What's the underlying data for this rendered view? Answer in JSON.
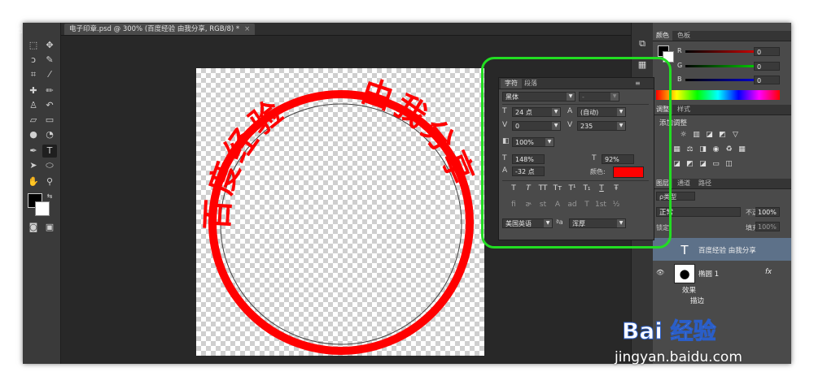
{
  "document_tab": {
    "title": "电子印章.psd @ 300% (百度经验  由我分享, RGB/8) *",
    "close": "×"
  },
  "char_panel": {
    "tabs": [
      "字符",
      "段落"
    ],
    "font_family": "黑体",
    "font_style": "-",
    "font_size": "24 点",
    "leading": "(自动)",
    "kerning": "0",
    "tracking": "235",
    "vertical_scale": "100%",
    "horizontal_scale": "148%",
    "baseline_shift": "-32 点",
    "horizontal_scale2": "92%",
    "color_label": "颜色:",
    "style_buttons": [
      "T",
      "T",
      "TT",
      "Tт",
      "T¹",
      "T₁",
      "T",
      "Ŧ"
    ],
    "opentype_buttons": [
      "fi",
      "ɚ",
      "st",
      "A",
      "ad",
      "T",
      "1st",
      "½"
    ],
    "language": "美国英语",
    "aa_label": "a",
    "antialias": "浑厚",
    "color": "#ff0000"
  },
  "color_panel": {
    "tabs": [
      "颜色",
      "色板"
    ],
    "r_label": "R",
    "g_label": "G",
    "b_label": "B",
    "r": "0",
    "g": "0",
    "b": "0"
  },
  "adjust_panel": {
    "tabs": [
      "调整",
      "样式"
    ],
    "title": "添加调整"
  },
  "layers_panel": {
    "tabs": [
      "图层",
      "通道",
      "路径"
    ],
    "kind_label": "ρ类型",
    "blend_mode": "正常",
    "opacity_label": "不透明度:",
    "opacity": "100%",
    "lock_label": "锁定:",
    "fill_label": "填充:",
    "fill": "100%",
    "layers": [
      {
        "name": "百度经验  由我分享",
        "thumb": "T",
        "selected": true
      },
      {
        "name": "椭圆 1",
        "thumb": "●",
        "fx": "fx"
      },
      {
        "name": "效果"
      },
      {
        "name": "描边"
      }
    ]
  },
  "watermark": {
    "logo_text": "Bai 经验",
    "url": "jingyan.baidu.com"
  },
  "stamp_text": {
    "left": "百度经验",
    "right": "由我分享"
  }
}
